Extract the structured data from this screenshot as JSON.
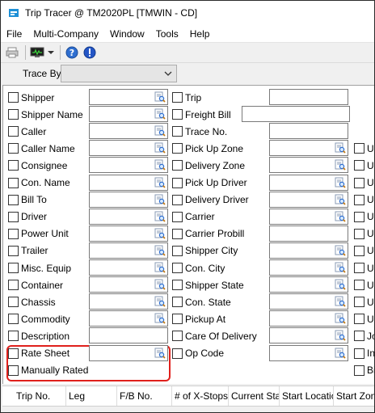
{
  "window": {
    "title": "Trip Tracer @ TM2020PL [TMWIN - CD]"
  },
  "menu": [
    "File",
    "Multi-Company",
    "Window",
    "Tools",
    "Help"
  ],
  "toolbar": {
    "icons": [
      "print-icon",
      "monitor-icon",
      "dropdown-arrow-icon",
      "help-icon",
      "info-icon"
    ]
  },
  "trace_by": {
    "label": "Trace By",
    "value": ""
  },
  "col1": [
    {
      "label": "Shipper",
      "field": true
    },
    {
      "label": "Shipper Name",
      "field": true
    },
    {
      "label": "Caller",
      "field": true
    },
    {
      "label": "Caller Name",
      "field": true
    },
    {
      "label": "Consignee",
      "field": true
    },
    {
      "label": "Con. Name",
      "field": true
    },
    {
      "label": "Bill To",
      "field": true
    },
    {
      "label": "Driver",
      "field": true
    },
    {
      "label": "Power Unit",
      "field": true
    },
    {
      "label": "Trailer",
      "field": true
    },
    {
      "label": "Misc. Equip",
      "field": true
    },
    {
      "label": "Container",
      "field": true
    },
    {
      "label": "Chassis",
      "field": true
    },
    {
      "label": "Commodity",
      "field": true
    },
    {
      "label": "Description",
      "field": "plain"
    },
    {
      "label": "Rate Sheet",
      "field": true
    },
    {
      "label": "Manually Rated",
      "field": false
    }
  ],
  "col2": [
    {
      "label": "Trip",
      "field": "plain"
    },
    {
      "label": "Freight Bill",
      "field": "wide"
    },
    {
      "label": "Trace No.",
      "field": "plain"
    },
    {
      "label": "Pick Up Zone",
      "field": true
    },
    {
      "label": "Delivery Zone",
      "field": true
    },
    {
      "label": "Pick Up Driver",
      "field": true
    },
    {
      "label": "Delivery Driver",
      "field": true
    },
    {
      "label": "Carrier",
      "field": true
    },
    {
      "label": "Carrier Probill",
      "field": "plain"
    },
    {
      "label": "Shipper City",
      "field": true
    },
    {
      "label": "Con. City",
      "field": true
    },
    {
      "label": "Shipper State",
      "field": true
    },
    {
      "label": "Con. State",
      "field": true
    },
    {
      "label": "Pickup At",
      "field": true
    },
    {
      "label": "Care Of Delivery",
      "field": true
    },
    {
      "label": "Op Code",
      "field": true
    }
  ],
  "col3": [
    "U",
    "U",
    "U",
    "U",
    "U",
    "U",
    "U",
    "U",
    "U",
    "U",
    "U",
    "Jo",
    "In",
    "Bi"
  ],
  "grid": {
    "columns": [
      "Trip No.",
      "Leg",
      "F/B No.",
      "# of X-Stops",
      "Current Status",
      "Start Location",
      "Start Zone"
    ]
  }
}
